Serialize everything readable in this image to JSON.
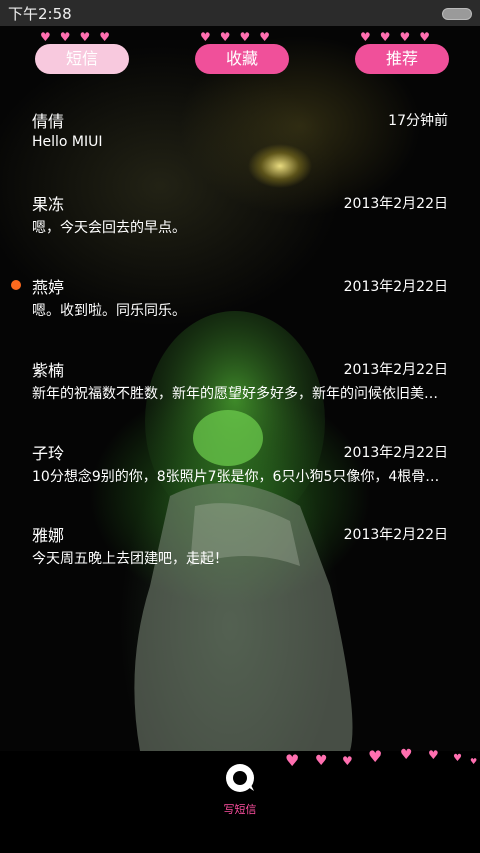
{
  "status_bar": {
    "time": "下午2:58"
  },
  "tabs": [
    {
      "label": "短信"
    },
    {
      "label": "收藏"
    },
    {
      "label": "推荐"
    }
  ],
  "messages": [
    {
      "name": "倩倩",
      "date": "17分钟前",
      "preview": "Hello MIUI",
      "unread": false
    },
    {
      "name": "果冻",
      "date": "2013年2月22日",
      "preview": "嗯，今天会回去的早点。",
      "unread": false
    },
    {
      "name": "燕婷",
      "date": "2013年2月22日",
      "preview": "嗯。收到啦。同乐同乐。",
      "unread": true
    },
    {
      "name": "紫楠",
      "date": "2013年2月22日",
      "preview": "新年的祝福数不胜数，新年的愿望好多好多，新年的问候依旧美好…",
      "unread": false
    },
    {
      "name": "子玲",
      "date": "2013年2月22日",
      "preview": "10分想念9别的你，8张照片7张是你，6只小狗5只像你，4根骨头…",
      "unread": false
    },
    {
      "name": "雅娜",
      "date": "2013年2月22日",
      "preview": "今天周五晚上去团建吧，走起！",
      "unread": false
    }
  ],
  "bottom": {
    "compose_label": "写短信"
  },
  "colors": {
    "accent": "#f0509a",
    "tab_active": "#f8c9de",
    "unread_dot": "#ff6a1e",
    "heart": "#ff6fb0"
  }
}
